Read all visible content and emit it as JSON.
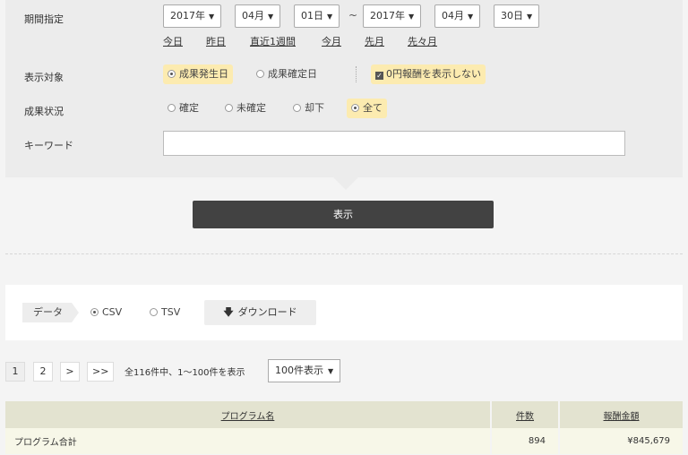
{
  "filters": {
    "period_label": "期間指定",
    "from": {
      "year": "2017年",
      "month": "04月",
      "day": "01日"
    },
    "tilde": "~",
    "to": {
      "year": "2017年",
      "month": "04月",
      "day": "30日"
    },
    "quick_links": [
      "今日",
      "昨日",
      "直近1週間",
      "今月",
      "先月",
      "先々月"
    ],
    "target_label": "表示対象",
    "target_options": [
      "成果発生日",
      "成果確定日"
    ],
    "target_selected": "成果発生日",
    "hide_zero_label": "0円報酬を表示しない",
    "hide_zero_checked": true,
    "status_label": "成果状況",
    "status_options": [
      "確定",
      "未確定",
      "却下",
      "全て"
    ],
    "status_selected": "全て",
    "keyword_label": "キーワード",
    "keyword_value": ""
  },
  "show_button": "表示",
  "download": {
    "label": "データ",
    "formats": [
      "CSV",
      "TSV"
    ],
    "selected": "CSV",
    "button": "ダウンロード"
  },
  "pagination": {
    "pages": [
      "1",
      "2",
      ">",
      ">>"
    ],
    "current": "1",
    "info": "全116件中、1～100件を表示",
    "per_page": "100件表示"
  },
  "table": {
    "headers": [
      "プログラム名",
      "件数",
      "報酬金額"
    ],
    "rows": [
      {
        "name": "プログラム合計",
        "count": "894",
        "amount": "¥845,679"
      }
    ]
  }
}
